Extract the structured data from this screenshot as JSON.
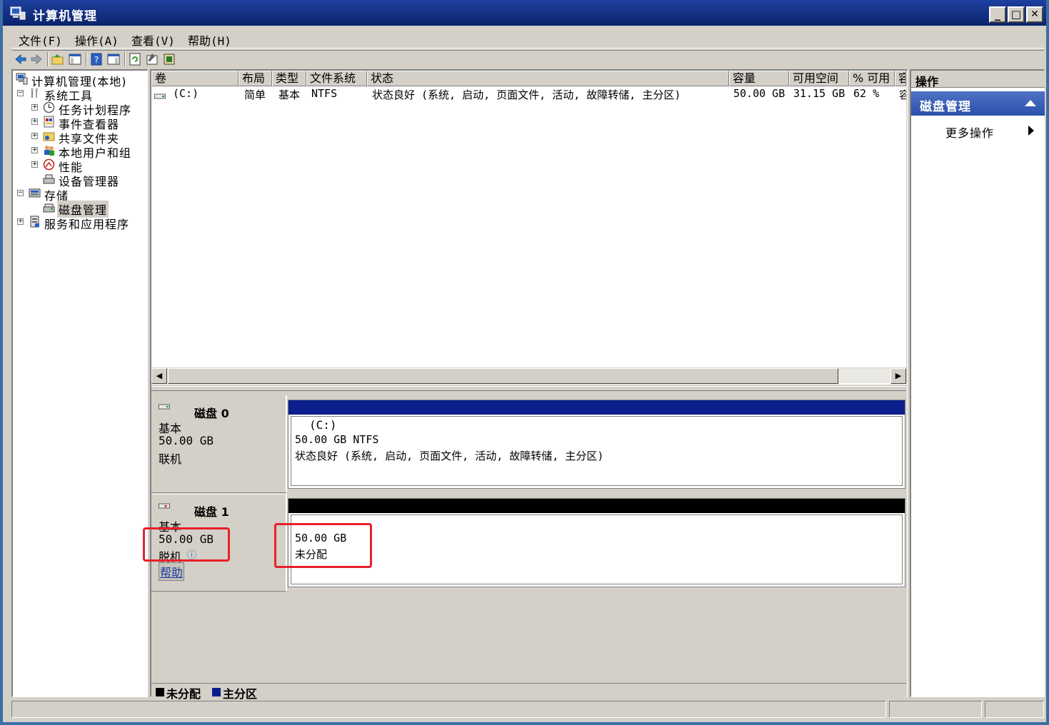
{
  "window": {
    "title": "计算机管理",
    "min_label": "_",
    "max_label": "□",
    "close_label": "✕"
  },
  "menu": [
    "文件(F)",
    "操作(A)",
    "查看(V)",
    "帮助(H)"
  ],
  "tree": {
    "root": "计算机管理(本地)",
    "system_tools": "系统工具",
    "task_scheduler": "任务计划程序",
    "event_viewer": "事件查看器",
    "shared_folders": "共享文件夹",
    "local_users": "本地用户和组",
    "performance": "性能",
    "device_manager": "设备管理器",
    "storage": "存储",
    "disk_management": "磁盘管理",
    "services_apps": "服务和应用程序",
    "expand_plus": "+",
    "expand_minus": "−"
  },
  "volumes": {
    "columns": [
      "卷",
      "布局",
      "类型",
      "文件系统",
      "状态",
      "容量",
      "可用空间",
      "% 可用",
      "容"
    ],
    "rows": [
      {
        "volume": "(C:)",
        "layout": "简单",
        "type": "基本",
        "fs": "NTFS",
        "status": "状态良好 (系统, 启动, 页面文件, 活动, 故障转储, 主分区)",
        "capacity": "50.00 GB",
        "free": "31.15 GB",
        "pct": "62 %",
        "more": "容"
      }
    ]
  },
  "disks": [
    {
      "name": "磁盘 0",
      "type": "基本",
      "size": "50.00 GB",
      "status": "联机",
      "partition": {
        "label": "(C:)",
        "size_fs": "50.00 GB NTFS",
        "status": "状态良好 (系统, 启动, 页面文件, 活动, 故障转储, 主分区)",
        "bar_color": "#0a1e8c"
      }
    },
    {
      "name": "磁盘 1",
      "type": "基本",
      "size": "50.00 GB",
      "status": "脱机",
      "info_icon": "ⓘ",
      "help_link": "帮助",
      "partition": {
        "size": "50.00 GB",
        "status": "未分配",
        "bar_color": "#000000"
      }
    }
  ],
  "legend": [
    {
      "label": "未分配",
      "color": "#000000"
    },
    {
      "label": "主分区",
      "color": "#0a1e8c"
    }
  ],
  "actions": {
    "header": "操作",
    "section": "磁盘管理",
    "more": "更多操作"
  },
  "accent": "#e8202a"
}
